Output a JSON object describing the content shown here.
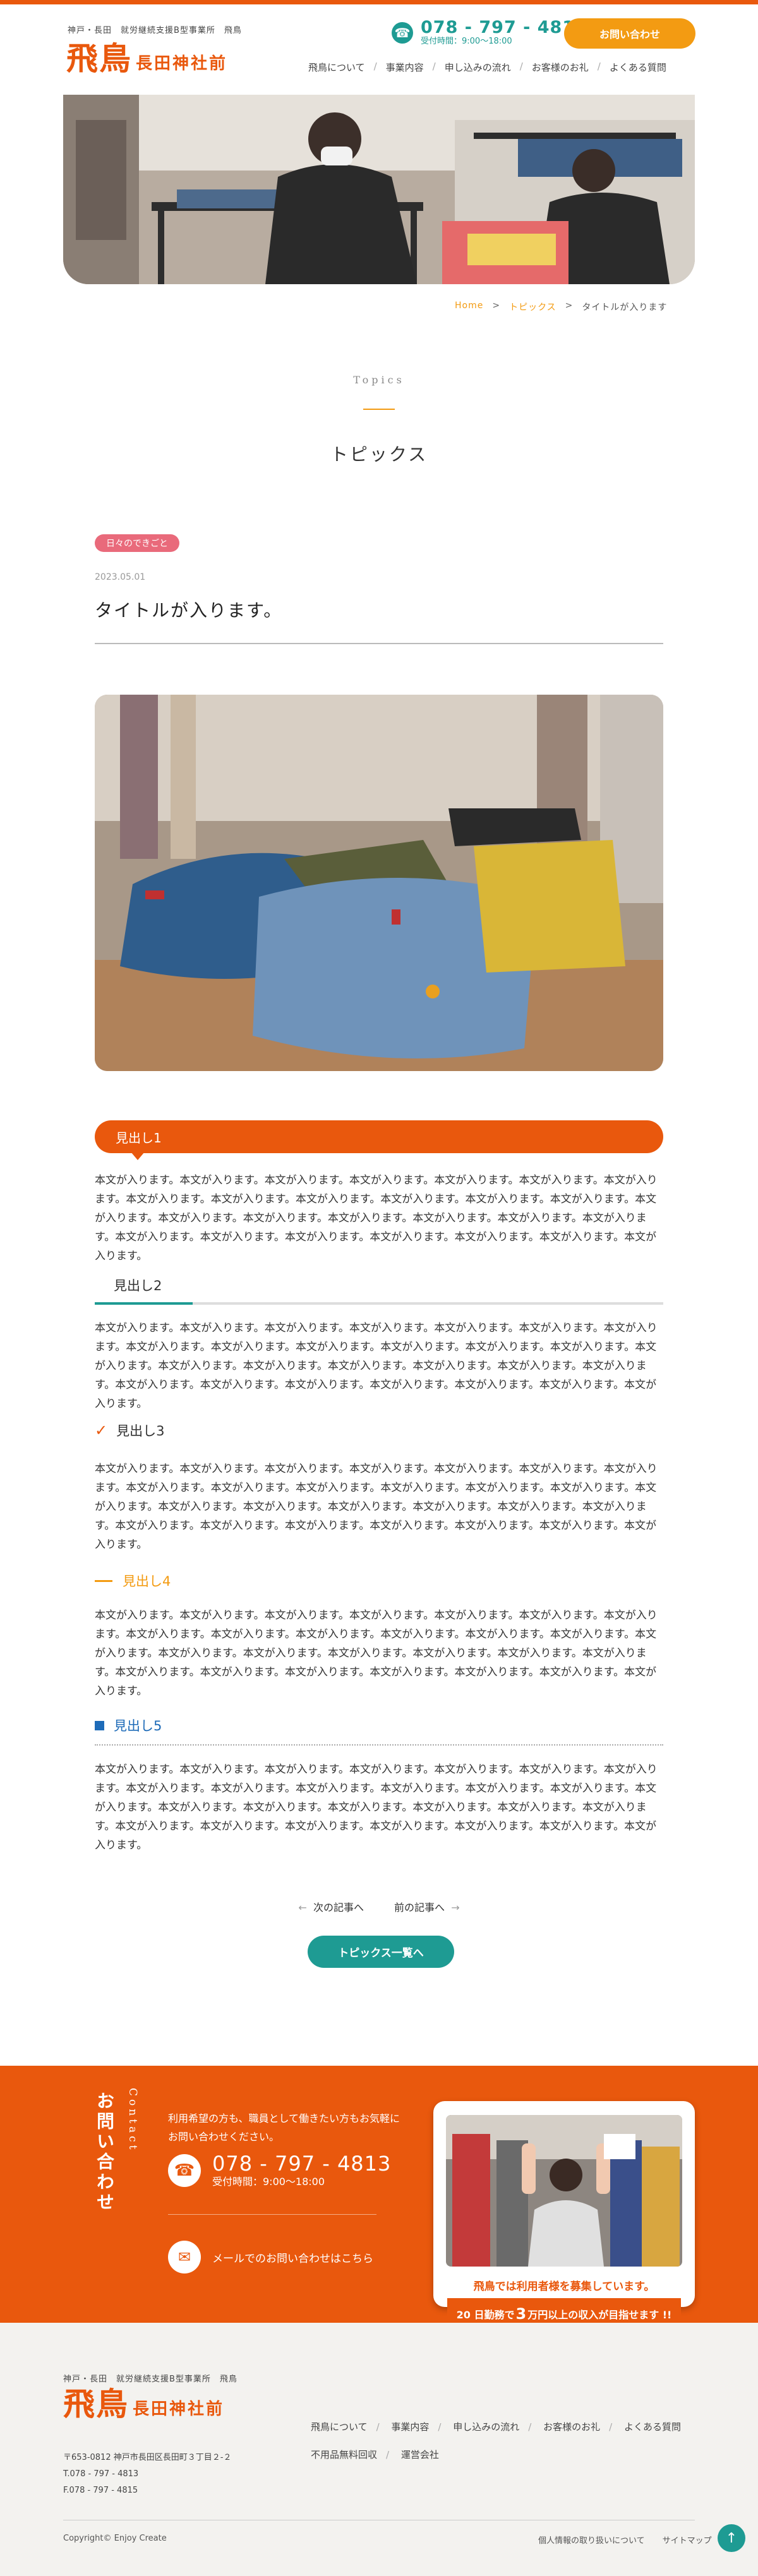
{
  "colors": {
    "accent": "#e9580d",
    "orange": "#f39b12",
    "teal": "#1e9b93",
    "blue": "#1e6bb8",
    "pink": "#e96a7b"
  },
  "header": {
    "sub": "神戸・長田　就労継続支援B型事業所　飛鳥",
    "logo_main": "飛鳥",
    "logo_sub": "長田神社前",
    "tel": "078 - 797 - 4813",
    "hours": "受付時間：9:00〜18:00",
    "contact_btn": "お問い合わせ",
    "nav": [
      "飛鳥について",
      "事業内容",
      "申し込みの流れ",
      "お客様のお礼",
      "よくある質問"
    ]
  },
  "breadcrumb": {
    "home": "Home",
    "sep": ">",
    "topics": "トピックス",
    "current": "タイトルが入ります"
  },
  "section": {
    "en": "Topics",
    "ja": "トピックス"
  },
  "post": {
    "category": "日々のできごと",
    "date": "2023.05.01",
    "title": "タイトルが入ります。",
    "h1": "見出し1",
    "h2": "見出し2",
    "h3": "見出し3",
    "h4": "見出し4",
    "h5": "見出し5",
    "body": "本文が入ります。本文が入ります。本文が入ります。本文が入ります。本文が入ります。本文が入ります。本文が入ります。本文が入ります。本文が入ります。本文が入ります。本文が入ります。本文が入ります。本文が入ります。本文が入ります。本文が入ります。本文が入ります。本文が入ります。本文が入ります。本文が入ります。本文が入ります。本文が入ります。本文が入ります。本文が入ります。本文が入ります。本文が入ります。本文が入ります。本文が入ります。"
  },
  "pager": {
    "next": "次の記事へ",
    "prev": "前の記事へ",
    "list": "トピックス一覧へ"
  },
  "contact": {
    "title_ja": "お問い合わせ",
    "title_en": "Contact",
    "lead": "利用希望の方も、職員として働きたい方もお気軽にお問い合わせください。",
    "tel": "078 - 797 - 4813",
    "hours": "受付時間：9:00〜18:00",
    "mail": "メールでのお問い合わせはこちら",
    "recruit_text": "飛鳥では利用者様を募集しています。",
    "banner_pre": "20 日勤務で",
    "banner_num": "3",
    "banner_post": "万円以上の収入が目指せます !!"
  },
  "footer": {
    "sub": "神戸・長田　就労継続支援B型事業所　飛鳥",
    "logo_main": "飛鳥",
    "logo_sub": "長田神社前",
    "address": "〒653-0812 神戸市長田区長田町３丁目２-２",
    "tel": "T.078 - 797 - 4813",
    "fax": "F.078 - 797 - 4815",
    "nav": [
      "飛鳥について",
      "事業内容",
      "申し込みの流れ",
      "お客様のお礼",
      "よくある質問",
      "不用品無料回収",
      "運営会社"
    ],
    "copyright": "Copyright© Enjoy Create",
    "privacy": "個人情報の取り扱いについて",
    "sitemap": "サイトマップ"
  }
}
